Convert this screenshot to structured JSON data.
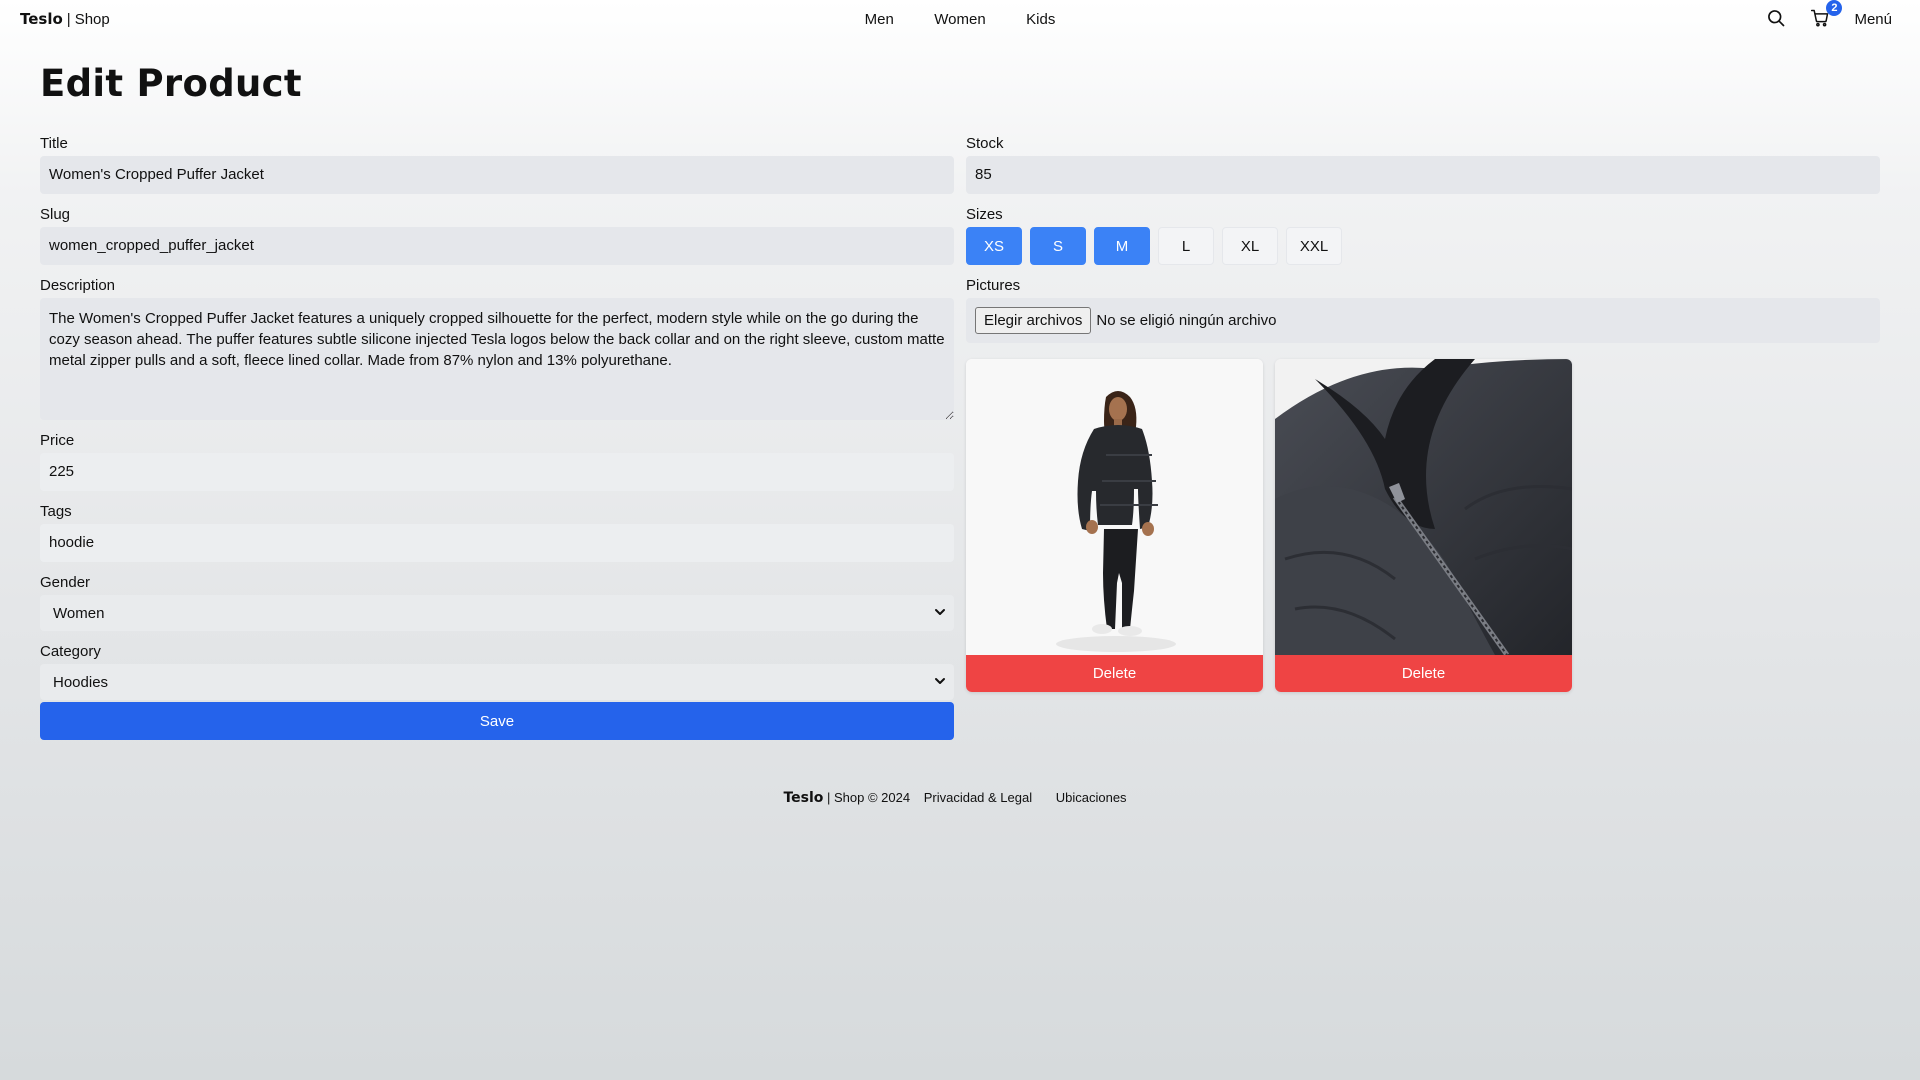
{
  "nav": {
    "brand_bold": "Teslo",
    "brand_sep": "|",
    "brand_rest": "Shop",
    "links": [
      "Men",
      "Women",
      "Kids"
    ],
    "cart_count": "2",
    "menu_label": "Menú"
  },
  "page": {
    "title": "Edit Product"
  },
  "form": {
    "title_label": "Title",
    "title_value": "Women's Cropped Puffer Jacket",
    "slug_label": "Slug",
    "slug_value": "women_cropped_puffer_jacket",
    "description_label": "Description",
    "description_value": "The Women's Cropped Puffer Jacket features a uniquely cropped silhouette for the perfect, modern style while on the go during the cozy season ahead. The puffer features subtle silicone injected Tesla logos below the back collar and on the right sleeve, custom matte metal zipper pulls and a soft, fleece lined collar. Made from 87% nylon and 13% polyurethane.",
    "price_label": "Price",
    "price_value": "225",
    "tags_label": "Tags",
    "tags_value": "hoodie",
    "gender_label": "Gender",
    "gender_value": "Women",
    "category_label": "Category",
    "category_value": "Hoodies",
    "save_label": "Save",
    "stock_label": "Stock",
    "stock_value": "85",
    "sizes_label": "Sizes",
    "sizes": [
      {
        "label": "XS",
        "selected": true
      },
      {
        "label": "S",
        "selected": true
      },
      {
        "label": "M",
        "selected": true
      },
      {
        "label": "L",
        "selected": false
      },
      {
        "label": "XL",
        "selected": false
      },
      {
        "label": "XXL",
        "selected": false
      }
    ],
    "pictures_label": "Pictures",
    "file_button_label": "Elegir archivos",
    "file_status": "No se eligió ningún archivo",
    "images": [
      {
        "delete_label": "Delete"
      },
      {
        "delete_label": "Delete"
      }
    ]
  },
  "footer": {
    "brand_bold": "Teslo",
    "brand_rest": "| Shop © 2024",
    "privacy": "Privacidad & Legal",
    "locations": "Ubicaciones"
  },
  "colors": {
    "accent": "#2563eb",
    "size_active": "#3b82f6",
    "danger": "#ef4444",
    "input_bg": "#e5e7eb"
  }
}
